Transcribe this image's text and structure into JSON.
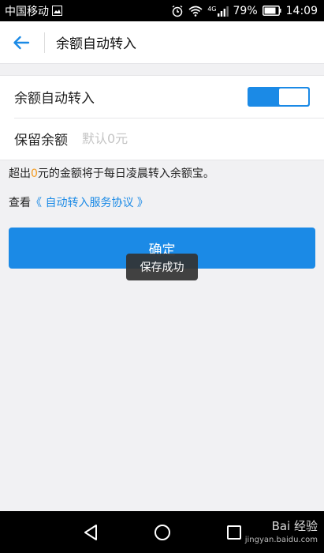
{
  "status_bar": {
    "carrier": "中国移动",
    "network": "4G",
    "battery": "79%",
    "time": "14:09"
  },
  "header": {
    "title": "余额自动转入",
    "back_icon": "arrow-left-icon"
  },
  "settings": {
    "auto_transfer_label": "余额自动转入",
    "auto_transfer_enabled": true,
    "reserve_label": "保留余额",
    "reserve_placeholder": "默认0元",
    "reserve_value": ""
  },
  "note": {
    "prefix": "超出",
    "highlight": "0",
    "suffix": "元的金额将于每日凌晨转入余额宝。"
  },
  "agreement": {
    "prefix": "查看",
    "link": "《 自动转入服务协议 》"
  },
  "confirm_label": "确定",
  "toast": "保存成功",
  "watermark": {
    "brand": "Bai 经验",
    "url": "jingyan.baidu.com"
  },
  "colors": {
    "accent": "#1b8ae6",
    "highlight": "#f39a1f"
  }
}
